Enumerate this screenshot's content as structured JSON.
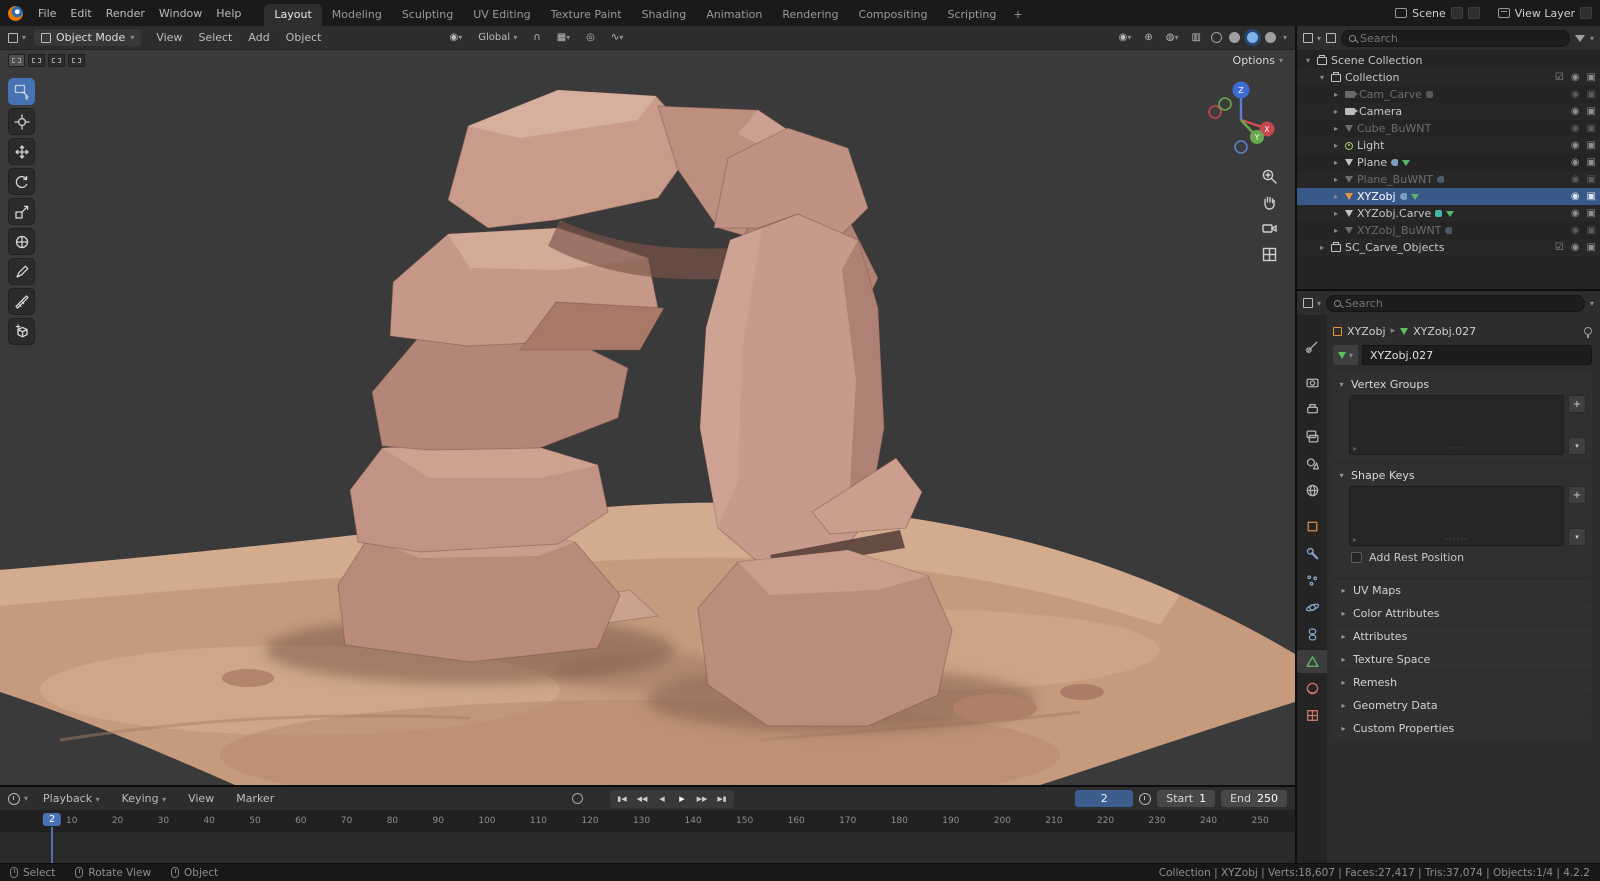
{
  "topbar": {
    "app_menus": [
      "File",
      "Edit",
      "Render",
      "Window",
      "Help"
    ],
    "workspaces": [
      "Layout",
      "Modeling",
      "Sculpting",
      "UV Editing",
      "Texture Paint",
      "Shading",
      "Animation",
      "Rendering",
      "Compositing",
      "Scripting"
    ],
    "active_workspace": "Layout",
    "add_workspace_label": "+",
    "scene_label": "Scene",
    "view_layer_label": "View Layer"
  },
  "viewport": {
    "mode_label": "Object Mode",
    "menus": [
      "View",
      "Select",
      "Add",
      "Object"
    ],
    "orientation_label": "Global",
    "options_label": "Options"
  },
  "outliner": {
    "search_placeholder": "Search",
    "rows": [
      {
        "name": "Scene Collection",
        "type": "collection"
      },
      {
        "name": "Collection",
        "type": "collection"
      },
      {
        "name": "Cam_Carve",
        "type": "camera",
        "state": "dimmed"
      },
      {
        "name": "Camera",
        "type": "camera"
      },
      {
        "name": "Cube_BuWNT",
        "type": "mesh",
        "state": "dimmed"
      },
      {
        "name": "Light",
        "type": "light"
      },
      {
        "name": "Plane",
        "type": "mesh"
      },
      {
        "name": "Plane_BuWNT",
        "type": "mesh",
        "state": "dimmed"
      },
      {
        "name": "XYZobj",
        "type": "mesh",
        "state": "selected"
      },
      {
        "name": "XYZobj.Carve",
        "type": "mesh"
      },
      {
        "name": "XYZobj_BuWNT",
        "type": "mesh",
        "state": "dimmed"
      },
      {
        "name": "SC_Carve_Objects",
        "type": "collection"
      }
    ]
  },
  "properties": {
    "search_placeholder": "Search",
    "breadcrumb_object": "XYZobj",
    "breadcrumb_data": "XYZobj.027",
    "name_value": "XYZobj.027",
    "vertex_groups_label": "Vertex Groups",
    "shape_keys_label": "Shape Keys",
    "add_rest_position_label": "Add Rest Position",
    "collapsed_panels": [
      "UV Maps",
      "Color Attributes",
      "Attributes",
      "Texture Space",
      "Remesh",
      "Geometry Data",
      "Custom Properties"
    ],
    "plus_label": "+",
    "dropdown_label": "▾"
  },
  "timeline": {
    "menus": [
      "Playback",
      "Keying",
      "View",
      "Marker"
    ],
    "transport_icons": [
      "▮◀",
      "◀◀",
      "◀",
      "▶",
      "▶▶",
      "▶▮"
    ],
    "current_frame": "2",
    "playhead_frame": "2",
    "start_label": "Start",
    "start_value": "1",
    "end_label": "End",
    "end_value": "250",
    "ticks": [
      "10",
      "20",
      "30",
      "40",
      "50",
      "60",
      "70",
      "80",
      "90",
      "100",
      "110",
      "120",
      "130",
      "140",
      "150",
      "160",
      "170",
      "180",
      "190",
      "200",
      "210",
      "220",
      "230",
      "240",
      "250"
    ]
  },
  "statusbar": {
    "left_items": [
      "Select",
      "Rotate View",
      "Object"
    ],
    "right_text": "Collection | XYZobj | Verts:18,607 | Faces:27,417 | Tris:37,074 | Objects:1/4 | 4.2.2"
  },
  "colors": {
    "accent": "#4772b3",
    "selected_row": "#39588a",
    "rock_base": "#bf9383",
    "sand_base": "#c59a7d"
  }
}
